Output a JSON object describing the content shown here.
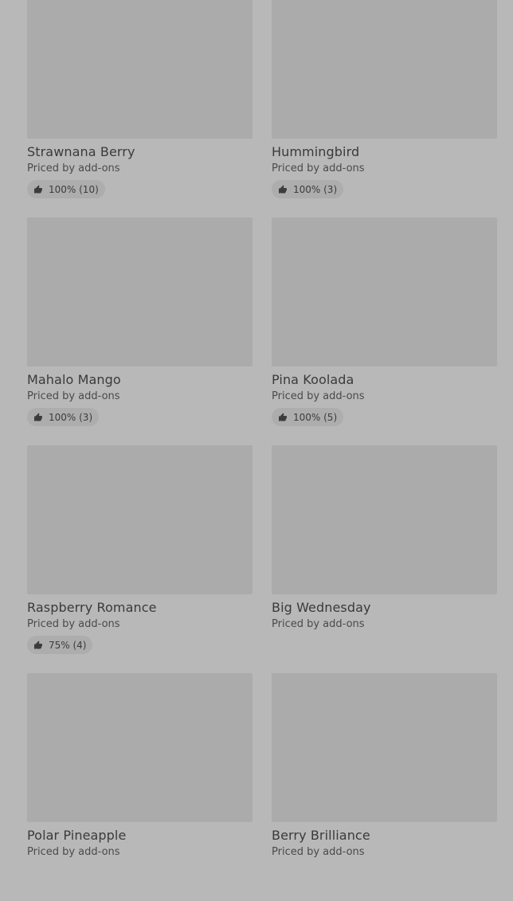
{
  "colors": {
    "background": "#b8b8b8",
    "thumbnail": "#ababab",
    "badge": "#adadad",
    "text": "#3a3a3a"
  },
  "games": [
    {
      "name": "Strawnana Berry",
      "price": "Priced by add-ons",
      "rating": "100% (10)"
    },
    {
      "name": "Hummingbird",
      "price": "Priced by add-ons",
      "rating": "100% (3)"
    },
    {
      "name": "Mahalo Mango",
      "price": "Priced by add-ons",
      "rating": "100% (3)"
    },
    {
      "name": "Pina Koolada",
      "price": "Priced by add-ons",
      "rating": "100% (5)"
    },
    {
      "name": "Raspberry Romance",
      "price": "Priced by add-ons",
      "rating": "75% (4)"
    },
    {
      "name": "Big Wednesday",
      "price": "Priced by add-ons",
      "rating": null
    },
    {
      "name": "Polar Pineapple",
      "price": "Priced by add-ons",
      "rating": null
    },
    {
      "name": "Berry Brilliance",
      "price": "Priced by add-ons",
      "rating": null
    }
  ]
}
